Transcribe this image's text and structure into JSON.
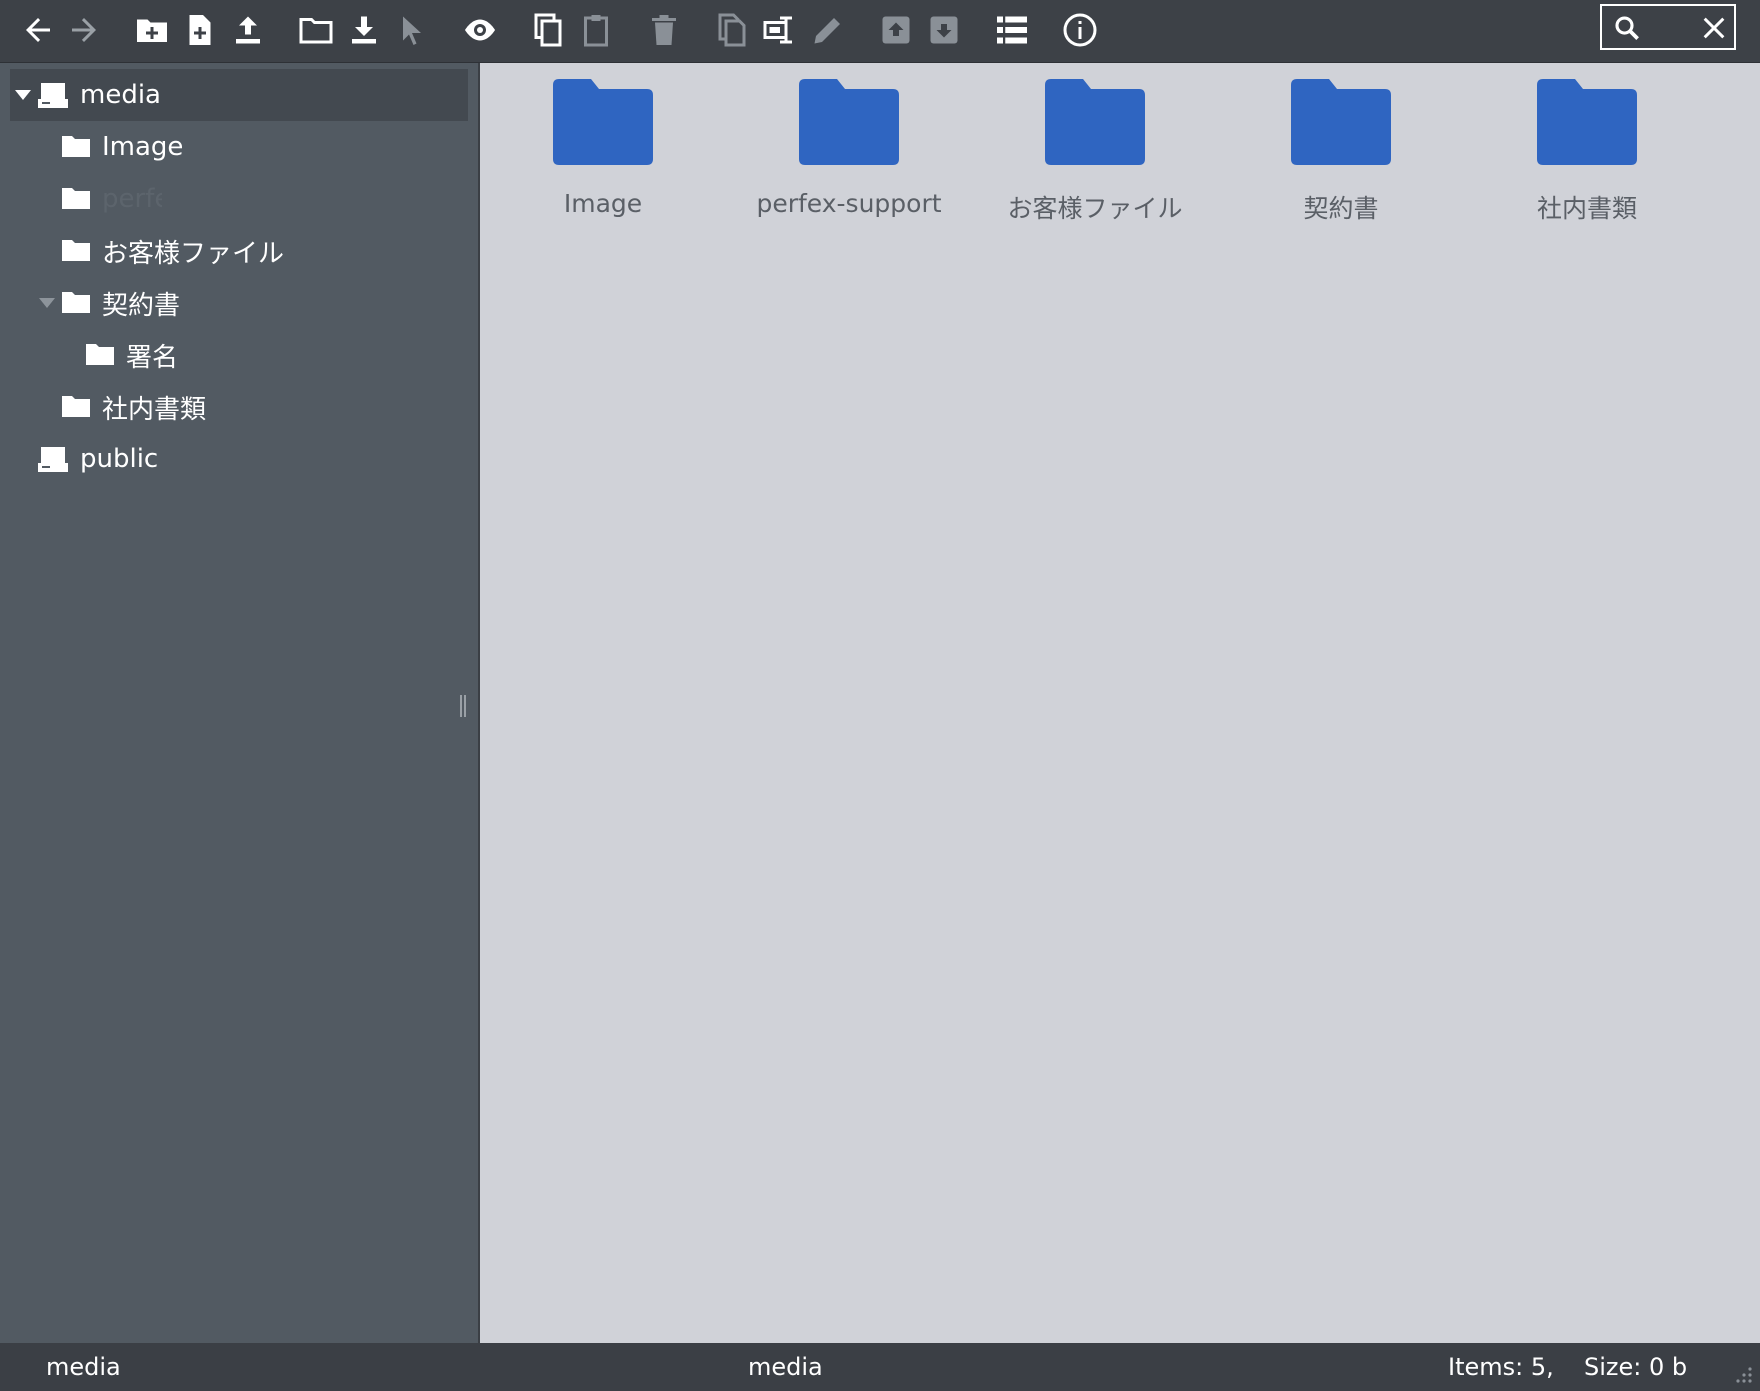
{
  "toolbar": {
    "icons": [
      {
        "name": "back-arrow-icon"
      },
      {
        "name": "forward-arrow-icon"
      },
      {
        "name": "new-folder-icon"
      },
      {
        "name": "new-file-icon"
      },
      {
        "name": "upload-icon"
      },
      {
        "name": "open-folder-icon"
      },
      {
        "name": "download-icon"
      },
      {
        "name": "select-cursor-icon"
      },
      {
        "name": "preview-eye-icon"
      },
      {
        "name": "copy-icon"
      },
      {
        "name": "paste-clipboard-icon"
      },
      {
        "name": "trash-icon"
      },
      {
        "name": "duplicate-icon"
      },
      {
        "name": "rename-icon"
      },
      {
        "name": "edit-pencil-icon"
      },
      {
        "name": "archive-icon"
      },
      {
        "name": "extract-icon"
      },
      {
        "name": "list-view-icon"
      },
      {
        "name": "info-icon"
      }
    ],
    "search": {
      "value": ""
    }
  },
  "tree": {
    "items": [
      {
        "label": "media",
        "type": "drive",
        "expanded": true,
        "selected": true
      },
      {
        "label": "Image",
        "type": "folder"
      },
      {
        "label": "perfex-support",
        "type": "folder",
        "faded": true
      },
      {
        "label": "お客様ファイル",
        "type": "folder"
      },
      {
        "label": "契約書",
        "type": "folder",
        "expanded": true
      },
      {
        "label": "署名",
        "type": "folder"
      },
      {
        "label": "社内書類",
        "type": "folder"
      },
      {
        "label": "public",
        "type": "drive"
      }
    ]
  },
  "content": {
    "folders": [
      {
        "label": "Image"
      },
      {
        "label": "perfex-support"
      },
      {
        "label": "お客様ファイル"
      },
      {
        "label": "契約書"
      },
      {
        "label": "社内書類"
      }
    ]
  },
  "status": {
    "left": "media",
    "center": "media",
    "items": "Items: 5,",
    "size": "Size: 0 b"
  },
  "colors": {
    "toolbar_bg": "#3d4147",
    "sidebar_bg": "#525a62",
    "content_bg": "#d0d2d8",
    "folder_blue": "#2f65c1"
  }
}
